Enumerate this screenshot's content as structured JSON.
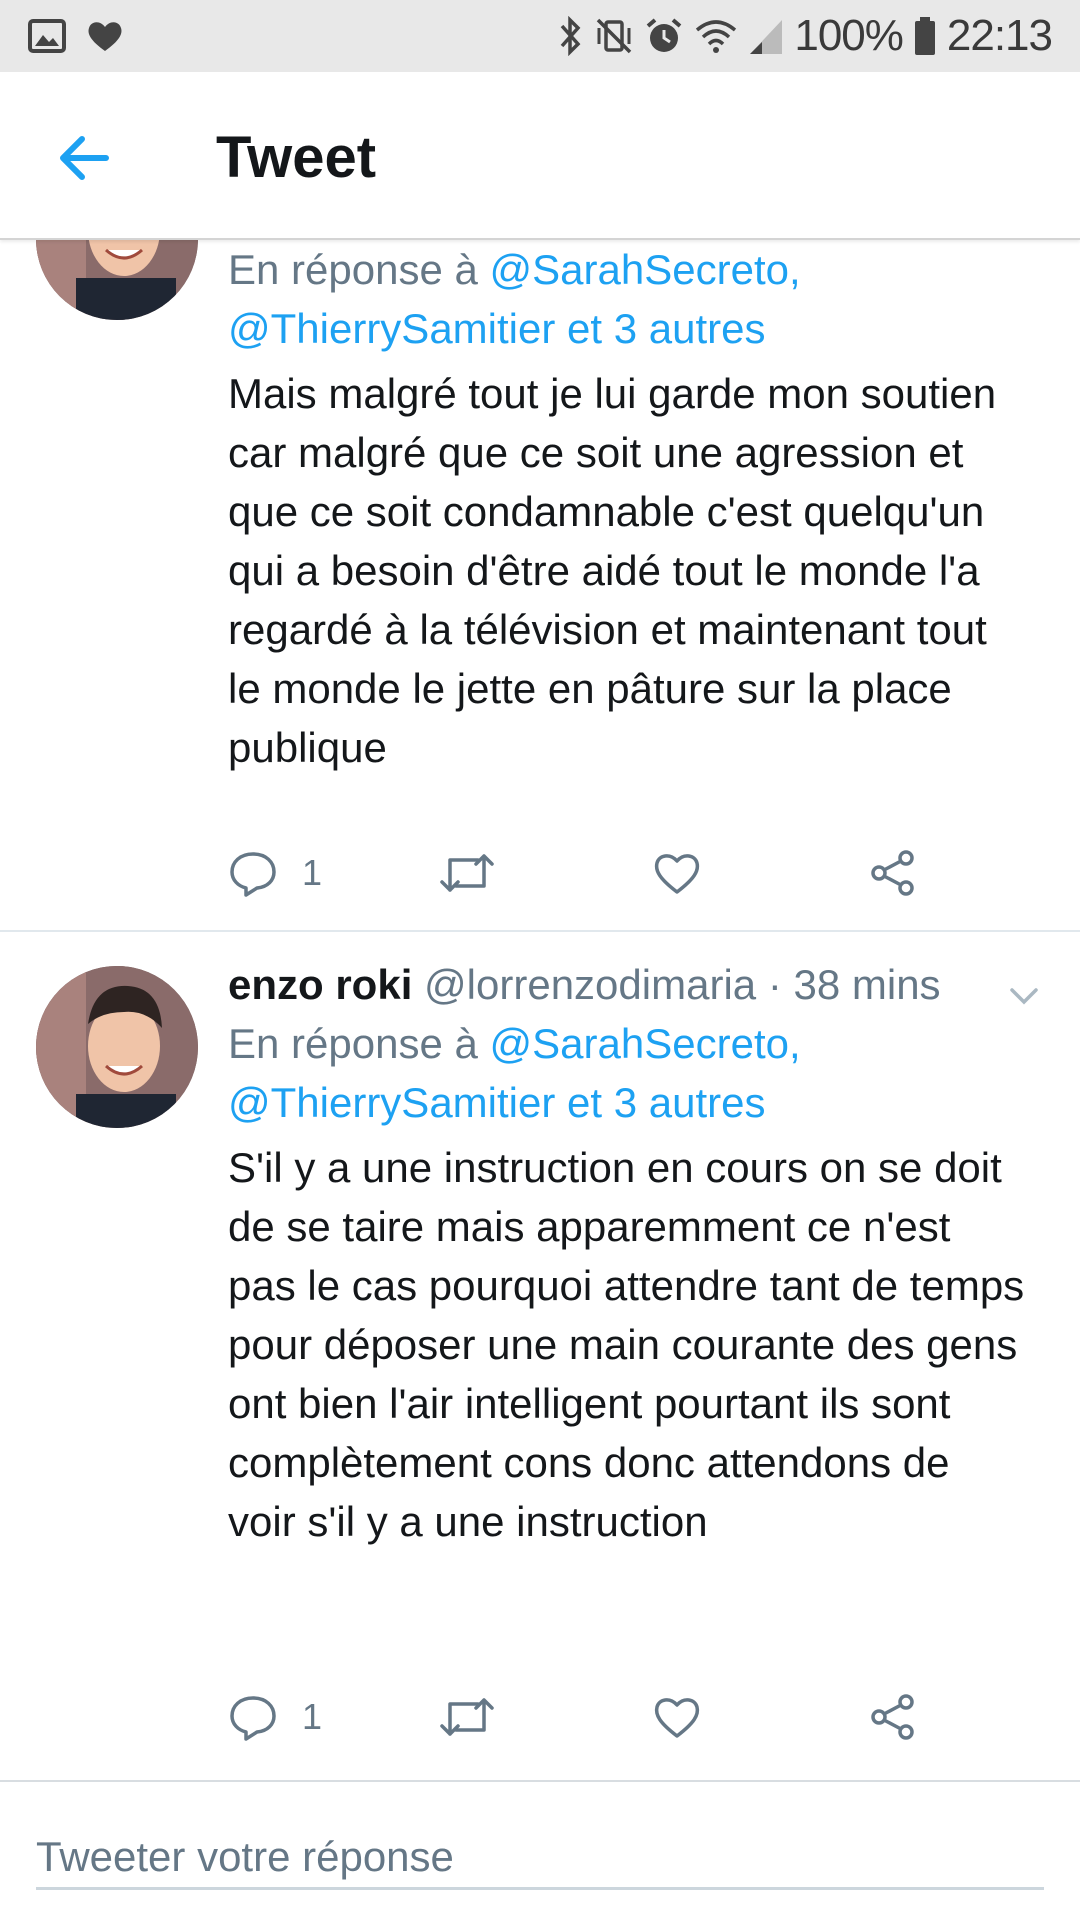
{
  "status_bar": {
    "left_icons": [
      "image-notification-icon",
      "heart-notification-icon"
    ],
    "right_icons": [
      "bluetooth-icon",
      "vibrate-mute-icon",
      "alarm-icon",
      "wifi-icon",
      "signal-icon",
      "battery-icon"
    ],
    "battery": "100%",
    "time": "22:13"
  },
  "header": {
    "back_icon": "arrow-left-icon",
    "title": "Tweet"
  },
  "colors": {
    "accent": "#1da1f2",
    "secondary_text": "#657786",
    "primary_text": "#14171a",
    "divider": "#e1e8ed"
  },
  "tweets": [
    {
      "reply_prefix": "En réponse à",
      "reply_mention_1": "@SarahSecreto,",
      "reply_mention_2": "@ThierrySamitier et 3 autres",
      "text": "Mais malgré tout je lui garde mon soutien car malgré que ce soit une agression et que ce soit condamnable c'est quelqu'un qui a besoin d'être aidé tout le monde l'a regardé à la télévision et maintenant tout le monde le jette en pâture sur la place publique",
      "reply_count": "1"
    },
    {
      "name": "enzo roki",
      "handle": "@lorrenzodimaria",
      "separator": "·",
      "time": "38 mins",
      "reply_prefix": "En réponse à",
      "reply_mention_1": "@SarahSecreto,",
      "reply_mention_2": "@ThierrySamitier et 3 autres",
      "text": "S'il y a une instruction en cours on se doit de se taire mais apparemment ce n'est pas le cas pourquoi attendre tant de temps pour déposer une main courante des gens ont bien l'air intelligent pourtant ils sont complètement cons donc attendons de voir s'il y a une instruction",
      "reply_count": "1"
    }
  ],
  "action_icons": [
    "reply-icon",
    "retweet-icon",
    "like-icon",
    "share-icon"
  ],
  "composer": {
    "placeholder": "Tweeter votre réponse",
    "value": ""
  }
}
